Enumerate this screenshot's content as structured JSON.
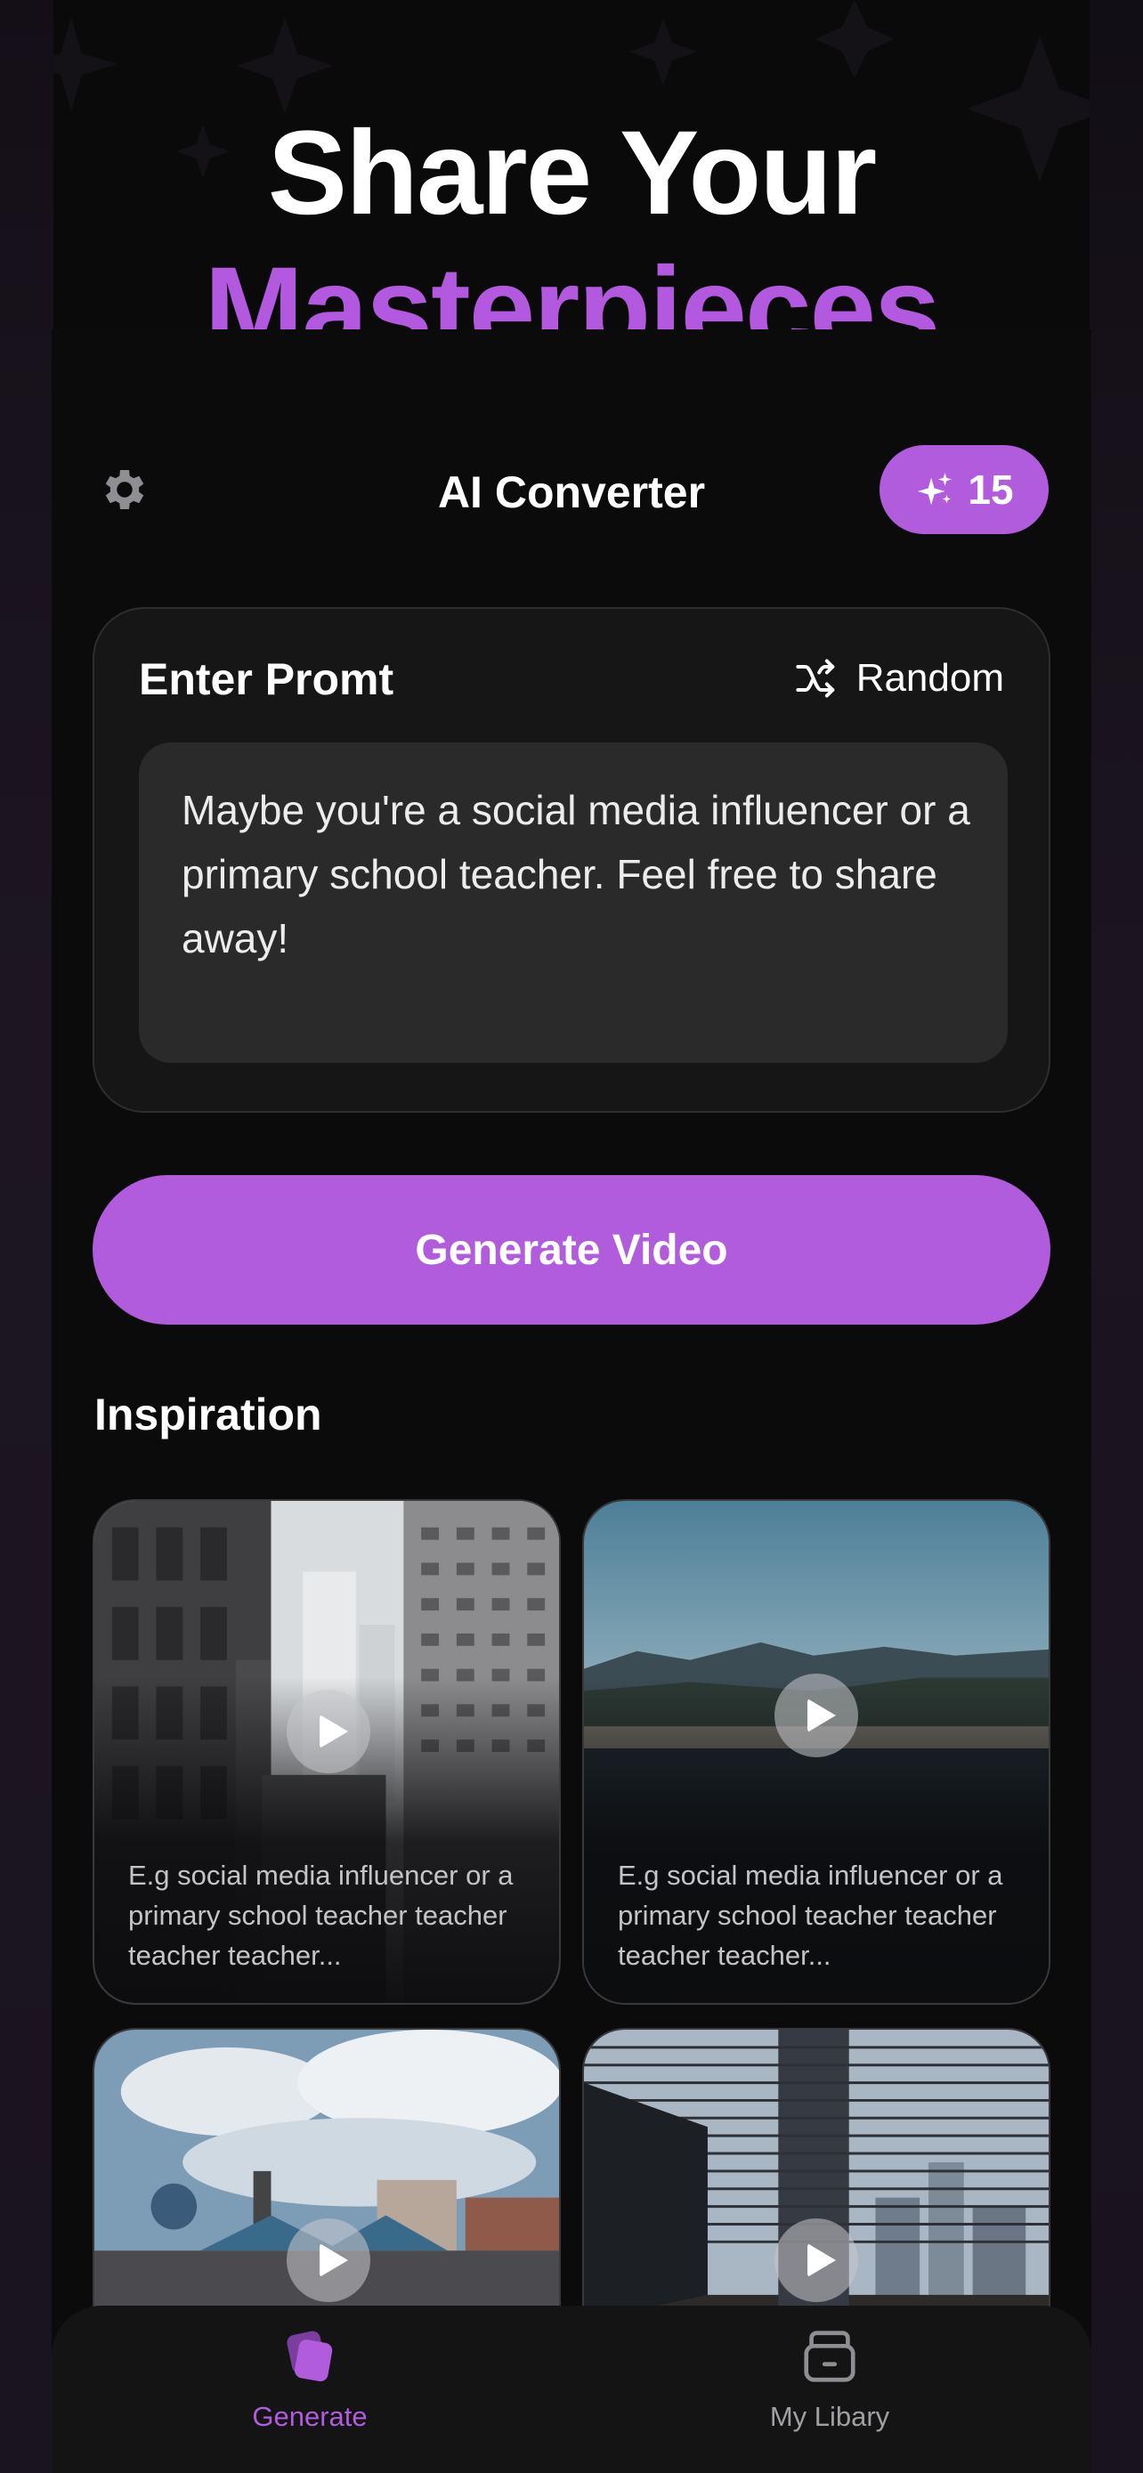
{
  "hero": {
    "line1": "Share Your",
    "line2": "Masterpieces"
  },
  "topbar": {
    "title": "AI Converter",
    "settings_icon": "gear-icon",
    "credits_icon": "sparkles-icon",
    "credits_count": "15"
  },
  "prompt": {
    "label": "Enter Promt",
    "random_label": "Random",
    "random_icon": "shuffle-icon",
    "text": "Maybe you're a social media influencer or a primary school teacher. Feel free to share away!"
  },
  "generate_button": "Generate Video",
  "inspiration": {
    "title": "Inspiration",
    "cards": [
      {
        "caption": "E.g social media influencer or a primary school teacher teacher teacher teacher...",
        "scene": "city towers"
      },
      {
        "caption": "E.g social media influencer or a primary school teacher teacher teacher teacher...",
        "scene": "lake shore"
      },
      {
        "caption": "",
        "scene": "fairground"
      },
      {
        "caption": "",
        "scene": "window blinds"
      }
    ]
  },
  "tabbar": {
    "tabs": [
      {
        "label": "Generate",
        "icon": "cards-icon",
        "active": true
      },
      {
        "label": "My Libary",
        "icon": "folder-icon",
        "active": false
      }
    ]
  },
  "colors": {
    "accent": "#b05cdc",
    "background": "#0a0a0b",
    "card": "#161617",
    "input": "#2a2a2b"
  }
}
